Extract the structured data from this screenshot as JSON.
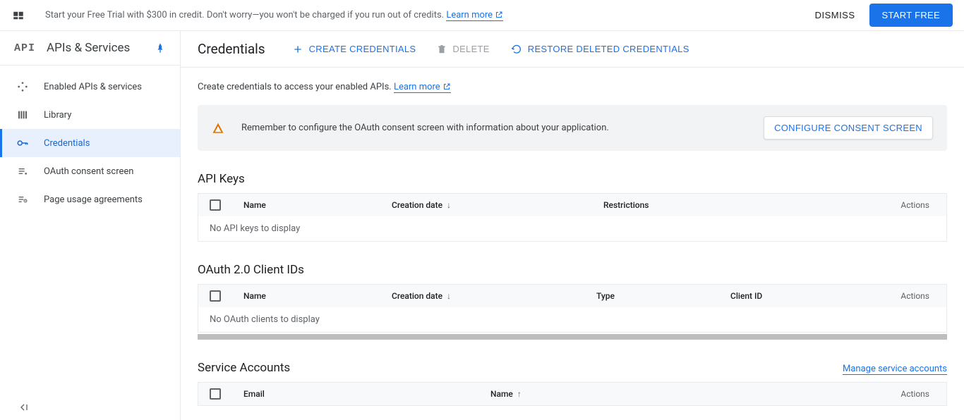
{
  "banner": {
    "text": "Start your Free Trial with $300 in credit. Don't worry—you won't be charged if you run out of credits. ",
    "learn_more": "Learn more",
    "dismiss": "DISMISS",
    "start_free": "START FREE"
  },
  "sidebar": {
    "logo": "API",
    "title": "APIs & Services",
    "items": [
      {
        "label": "Enabled APIs & services"
      },
      {
        "label": "Library"
      },
      {
        "label": "Credentials"
      },
      {
        "label": "OAuth consent screen"
      },
      {
        "label": "Page usage agreements"
      }
    ]
  },
  "header": {
    "title": "Credentials",
    "create": "CREATE CREDENTIALS",
    "delete": "DELETE",
    "restore": "RESTORE DELETED CREDENTIALS"
  },
  "intro": {
    "text": "Create credentials to access your enabled APIs. ",
    "learn_more": "Learn more"
  },
  "alert": {
    "text": "Remember to configure the OAuth consent screen with information about your application.",
    "button": "CONFIGURE CONSENT SCREEN"
  },
  "sections": {
    "api_keys": {
      "title": "API Keys",
      "cols": {
        "name": "Name",
        "creation": "Creation date",
        "restrictions": "Restrictions",
        "actions": "Actions"
      },
      "empty": "No API keys to display"
    },
    "oauth": {
      "title": "OAuth 2.0 Client IDs",
      "cols": {
        "name": "Name",
        "creation": "Creation date",
        "type": "Type",
        "client_id": "Client ID",
        "actions": "Actions"
      },
      "empty": "No OAuth clients to display"
    },
    "service": {
      "title": "Service Accounts",
      "manage": "Manage service accounts",
      "cols": {
        "email": "Email",
        "name": "Name",
        "actions": "Actions"
      }
    }
  }
}
